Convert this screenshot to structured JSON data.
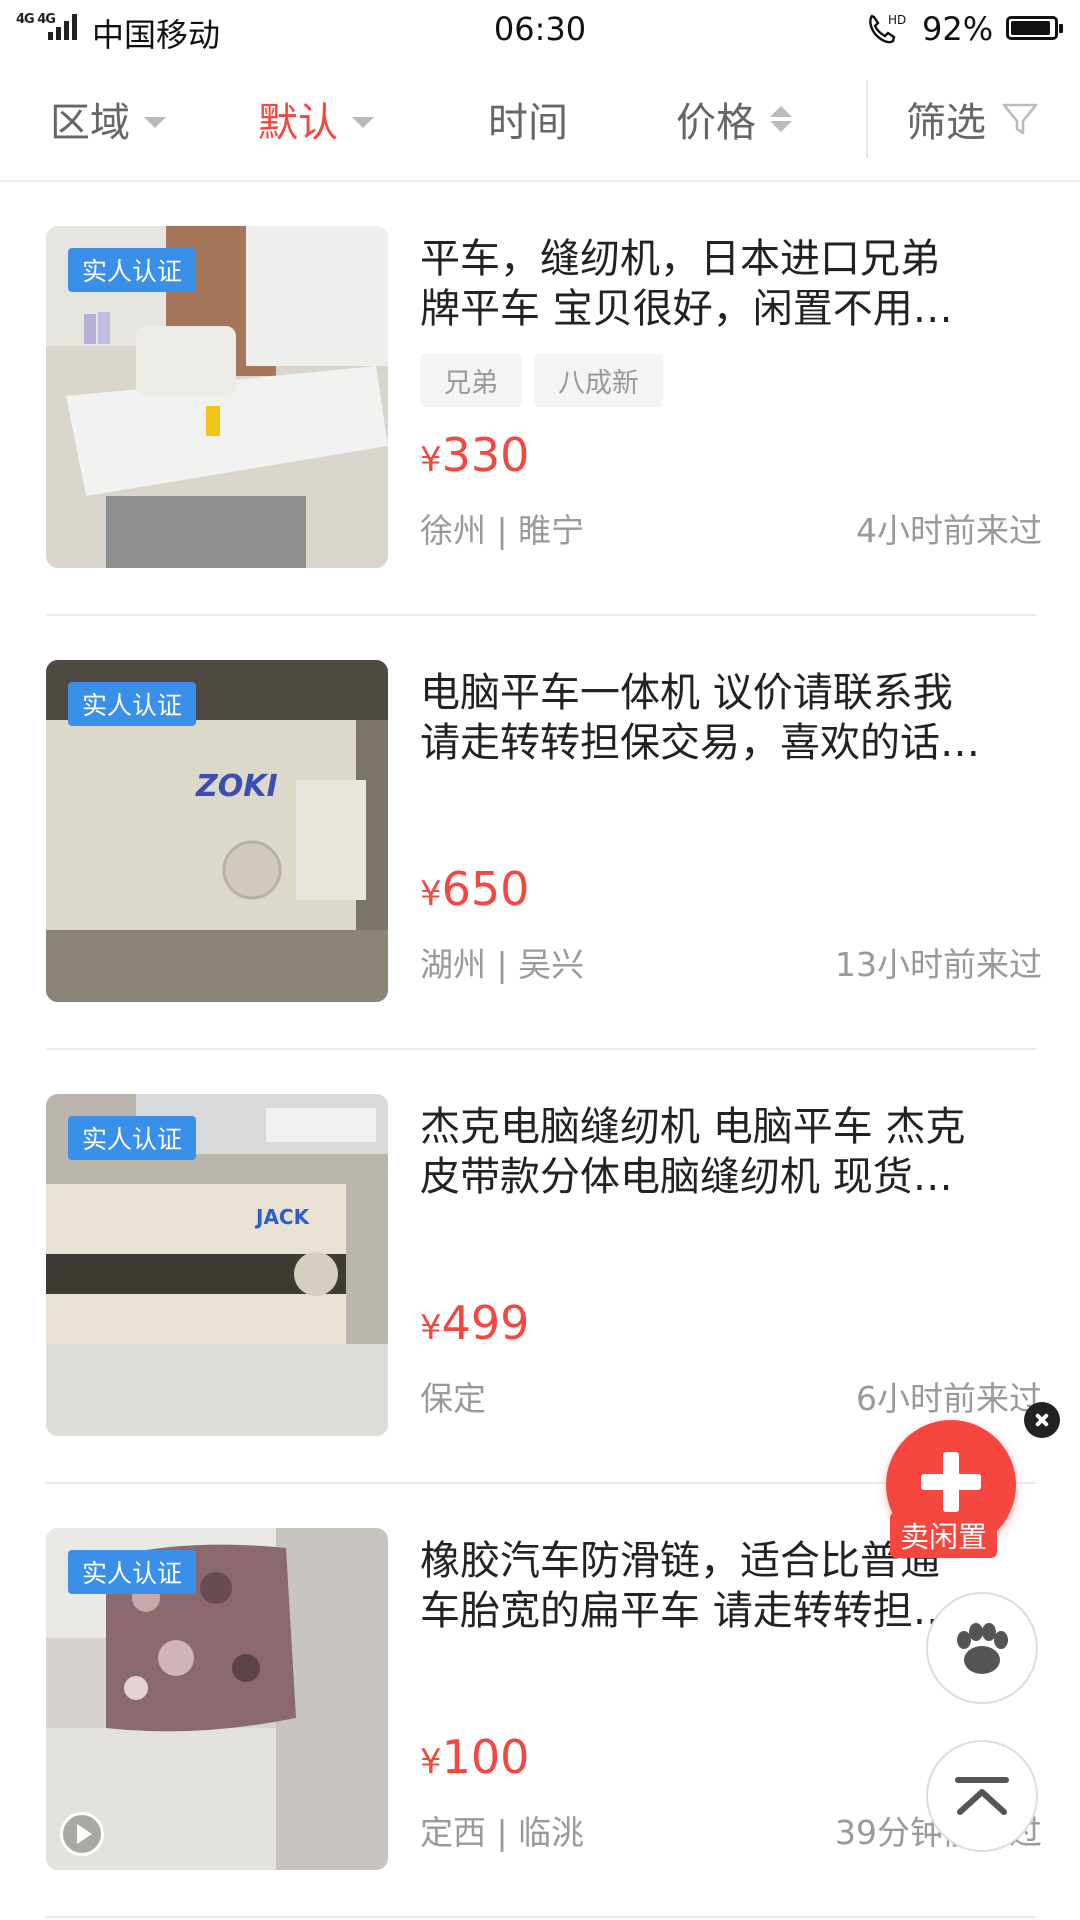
{
  "status_bar": {
    "network": "4G 4G",
    "carrier": "中国移动",
    "time": "06:30",
    "call_hd": "HD",
    "battery_percent": "92%",
    "battery_level": 0.92
  },
  "filter_bar": {
    "region": "区域",
    "default": "默认",
    "time": "时间",
    "price": "价格",
    "filter": "筛选",
    "active_color": "#f5473f"
  },
  "items": [
    {
      "badge": "实人认证",
      "title_line1": "平车，缝纫机，日本进口兄弟",
      "title_line2": "牌平车 宝贝很好，闲置不用…",
      "tags": [
        "兄弟",
        "八成新"
      ],
      "currency": "¥",
      "price": "330",
      "location": "徐州 | 睢宁",
      "last_seen": "4小时前来过",
      "image_icon": "sewing-machine-photo",
      "has_video": false
    },
    {
      "badge": "实人认证",
      "title_line1": "电脑平车一体机 议价请联系我",
      "title_line2": "请走转转担保交易，喜欢的话…",
      "tags": [],
      "currency": "¥",
      "price": "650",
      "location": "湖州 | 吴兴",
      "last_seen": "13小时前来过",
      "image_icon": "zoki-sewing-machine-photo",
      "image_brand": "ZOKI",
      "has_video": false
    },
    {
      "badge": "实人认证",
      "title_line1": "杰克电脑缝纫机 电脑平车 杰克",
      "title_line2": "皮带款分体电脑缝纫机  现货…",
      "tags": [],
      "currency": "¥",
      "price": "499",
      "location": "保定",
      "last_seen": "6小时前来过",
      "image_icon": "jack-sewing-machine-photo",
      "image_brand": "JACK",
      "has_video": false
    },
    {
      "badge": "实人认证",
      "title_line1": "橡胶汽车防滑链，适合比普通",
      "title_line2": "车胎宽的扁平车 请走转转担…",
      "tags": [],
      "currency": "¥",
      "price": "100",
      "location": "定西 | 临洮",
      "last_seen": "39分钟前来过",
      "image_icon": "camouflage-bag-photo",
      "has_video": true
    }
  ],
  "floating": {
    "sell_label": "卖闲置",
    "sell_color": "#f5473f",
    "close_icon": "close-icon",
    "paw_icon": "paw-icon",
    "back_to_top_icon": "back-to-top-icon"
  }
}
